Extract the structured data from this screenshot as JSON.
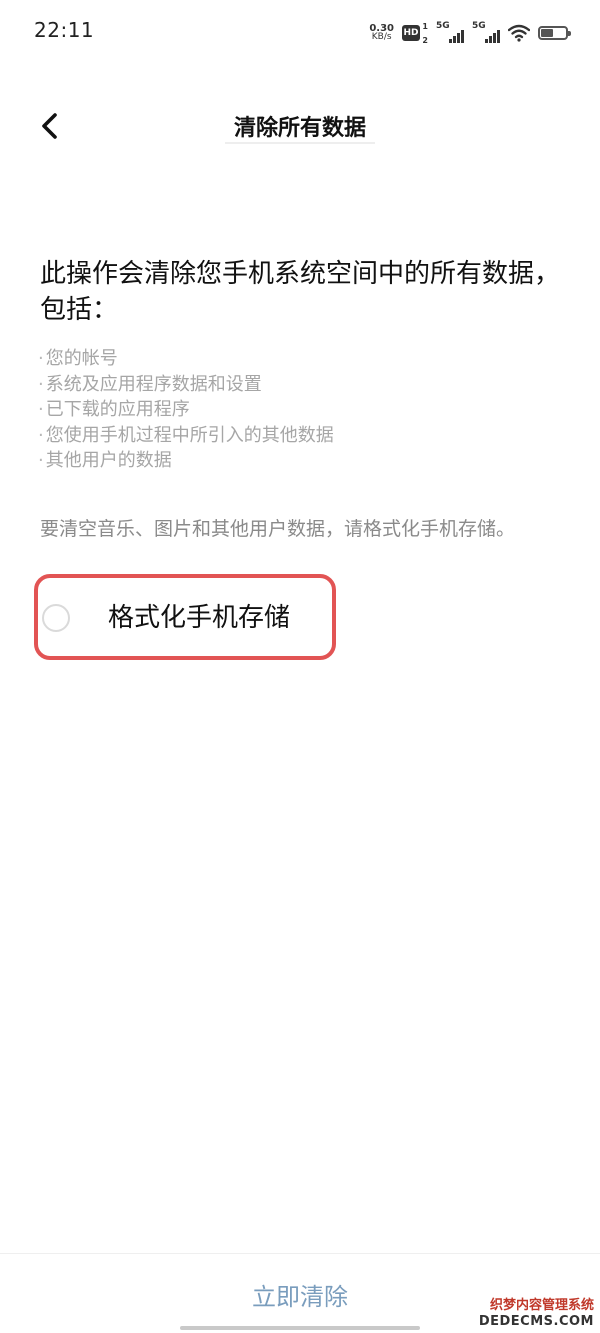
{
  "status_bar": {
    "time": "22:11",
    "net_speed_value": "0.30",
    "net_speed_unit": "KB/s",
    "hd_label": "HD",
    "hd_sub_top": "1",
    "hd_sub_bottom": "2",
    "sim1_label": "5G",
    "sim2_label": "5G",
    "icons": [
      "hd-icon",
      "signal-icon",
      "wifi-icon",
      "battery-icon"
    ]
  },
  "header": {
    "back_icon": "chevron-left-icon",
    "title": "清除所有数据"
  },
  "content": {
    "description": "此操作会清除您手机系统空间中的所有数据，包括：",
    "items": [
      "您的帐号",
      "系统及应用程序数据和设置",
      "已下载的应用程序",
      "您使用手机过程中所引入的其他数据",
      "其他用户的数据"
    ],
    "format_hint": "要清空音乐、图片和其他用户数据，请格式化手机存储。",
    "format_option": {
      "label": "格式化手机存储",
      "checked": false
    }
  },
  "footer": {
    "clear_button": "立即清除"
  },
  "watermark": {
    "line1": "织梦内容管理系统",
    "line2": "DEDECMS.COM"
  },
  "colors": {
    "highlight_border": "#e25454",
    "button_text": "#7a9dbd",
    "secondary_text": "#a6a6a6"
  }
}
